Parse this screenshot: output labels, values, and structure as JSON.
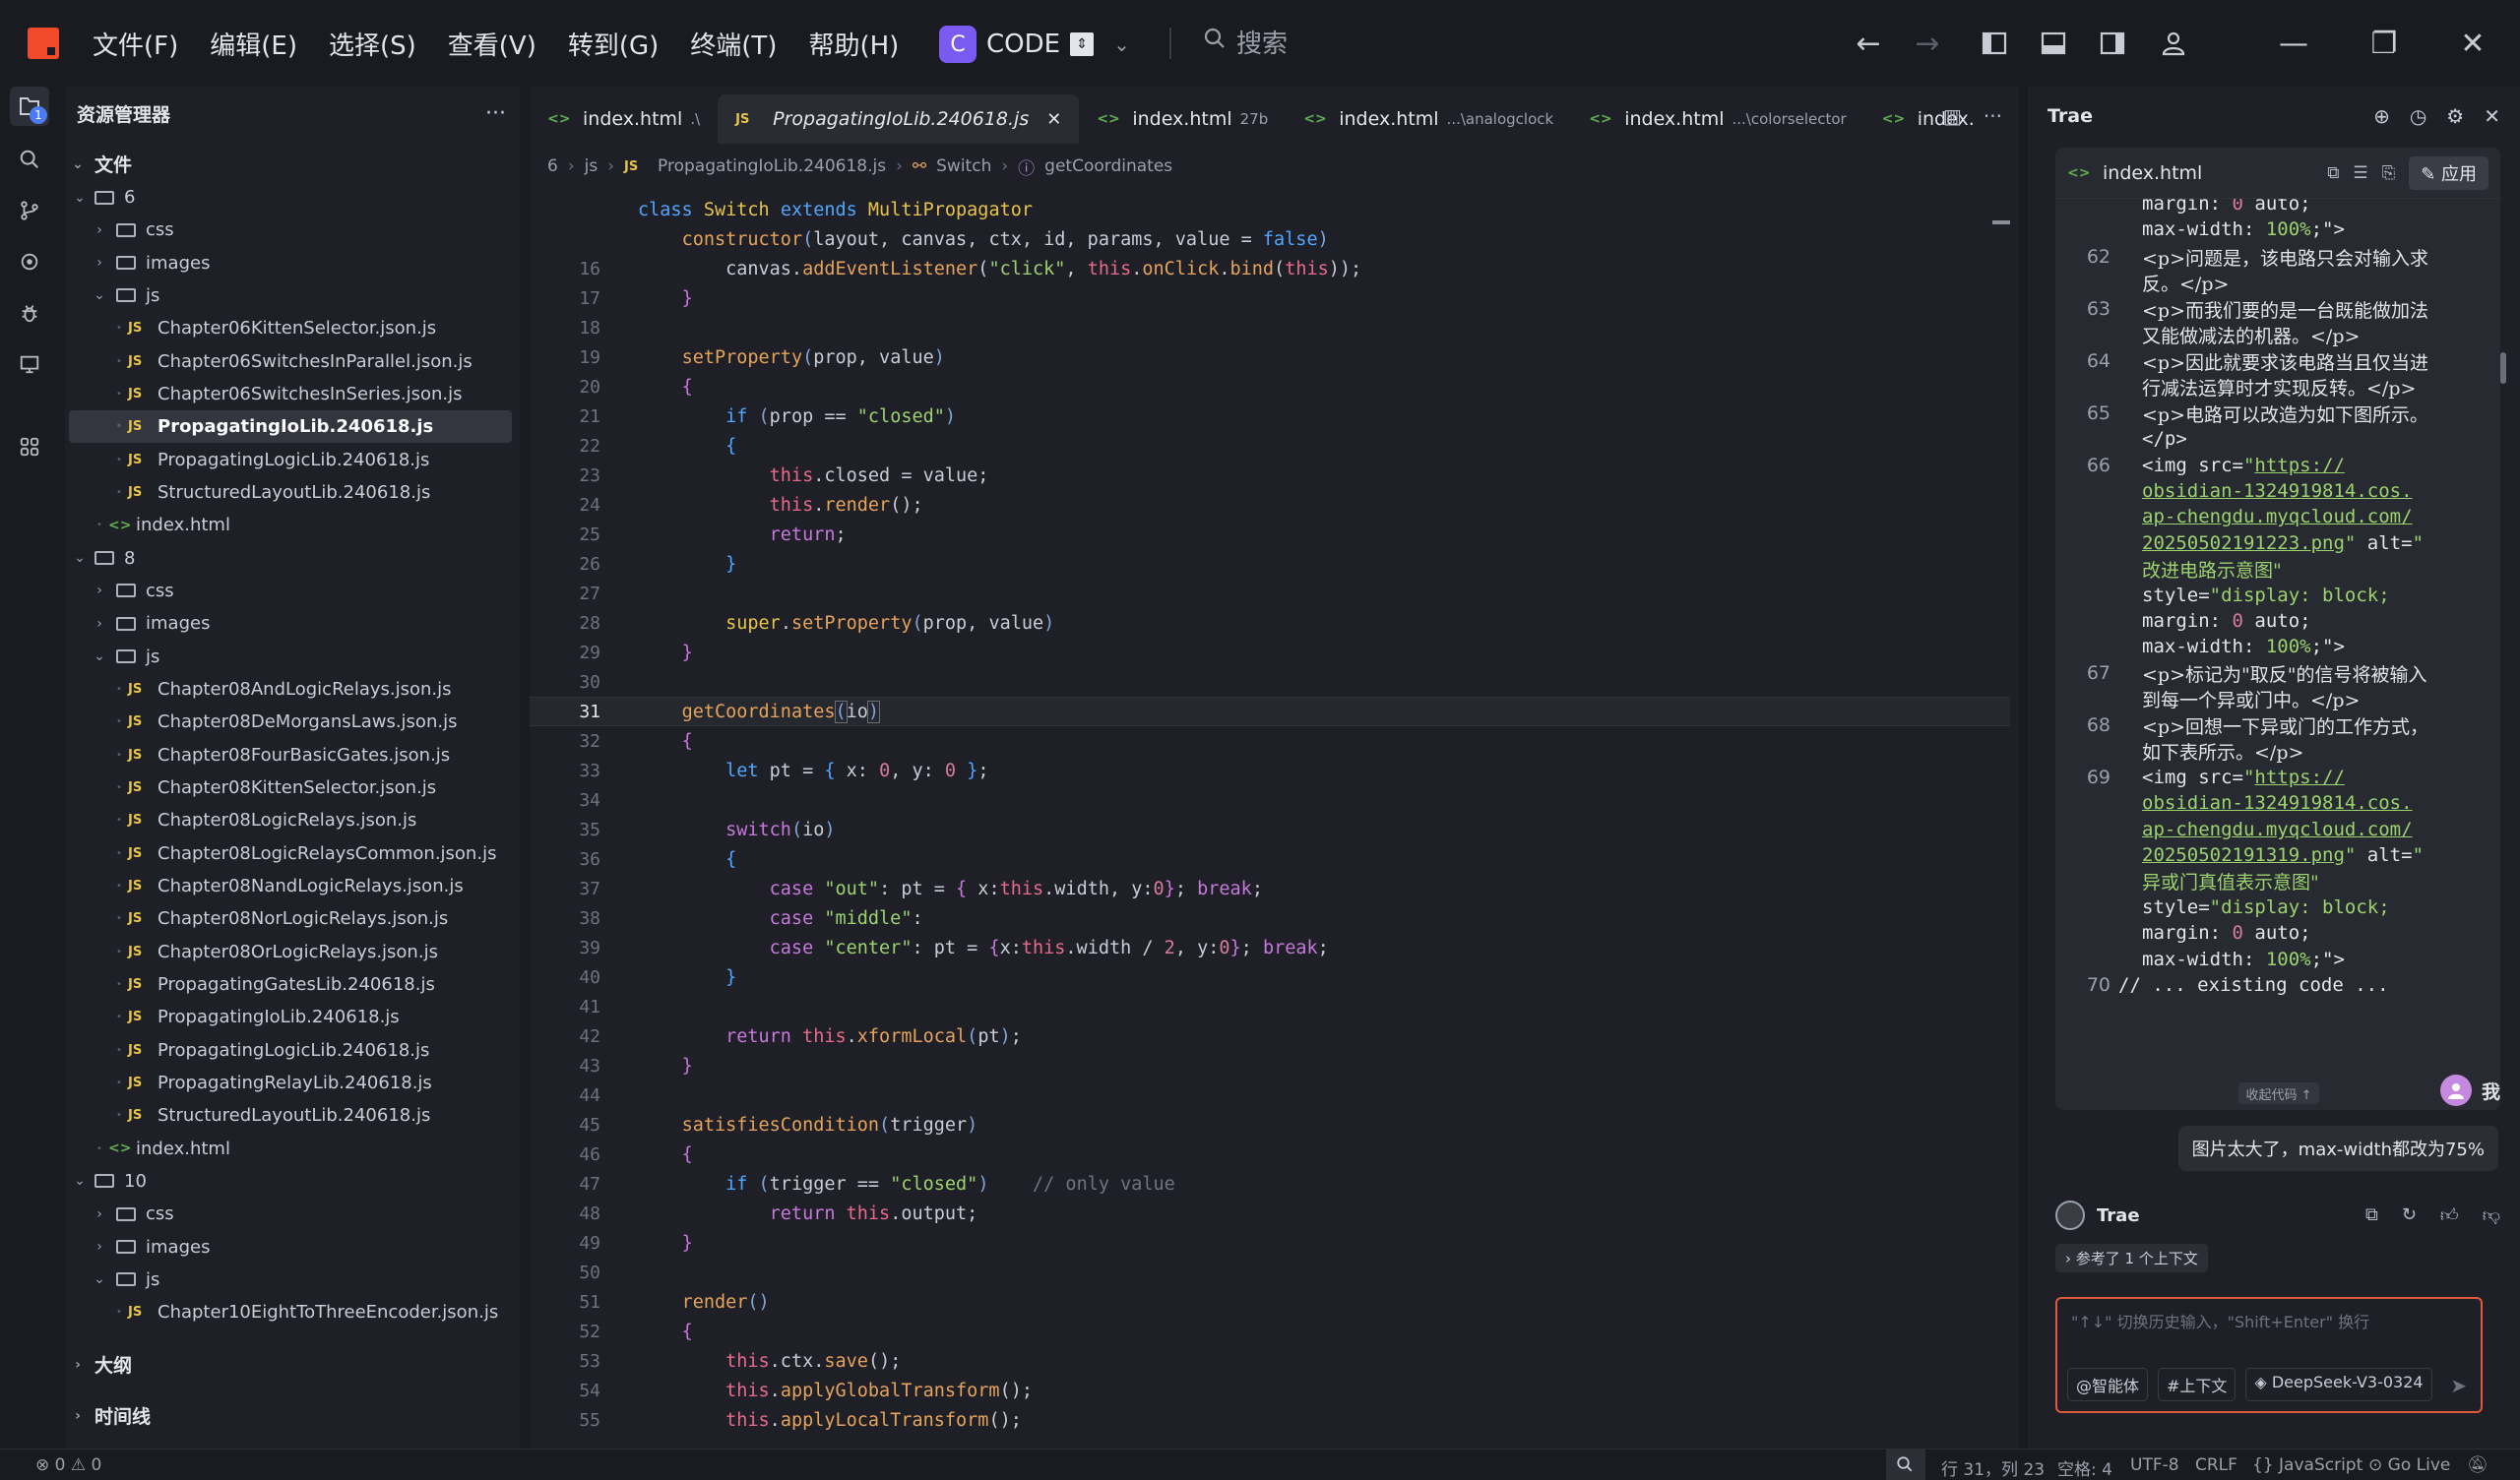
{
  "titlebar": {
    "menu": [
      "文件(F)",
      "编辑(E)",
      "选择(S)",
      "查看(V)",
      "转到(G)",
      "终端(T)",
      "帮助(H)"
    ],
    "project_badge": "C",
    "project_name": "CODE",
    "search_placeholder": "搜索"
  },
  "explorer": {
    "title": "资源管理器",
    "root_label": "文件",
    "rows": [
      {
        "label": "6",
        "kind": "folder"
      },
      {
        "label": "css",
        "kind": "folder"
      },
      {
        "label": "images",
        "kind": "folder"
      },
      {
        "label": "js",
        "kind": "folder"
      },
      {
        "label": "Chapter06KittenSelector.json.js",
        "kind": "js"
      },
      {
        "label": "Chapter06SwitchesInParallel.json.js",
        "kind": "js"
      },
      {
        "label": "Chapter06SwitchesInSeries.json.js",
        "kind": "js"
      },
      {
        "label": "PropagatingIoLib.240618.js",
        "kind": "js"
      },
      {
        "label": "PropagatingLogicLib.240618.js",
        "kind": "js"
      },
      {
        "label": "StructuredLayoutLib.240618.js",
        "kind": "js"
      },
      {
        "label": "index.html",
        "kind": "html"
      },
      {
        "label": "8",
        "kind": "folder"
      },
      {
        "label": "css",
        "kind": "folder"
      },
      {
        "label": "images",
        "kind": "folder"
      },
      {
        "label": "js",
        "kind": "folder"
      },
      {
        "label": "Chapter08AndLogicRelays.json.js",
        "kind": "js"
      },
      {
        "label": "Chapter08DeMorgansLaws.json.js",
        "kind": "js"
      },
      {
        "label": "Chapter08FourBasicGates.json.js",
        "kind": "js"
      },
      {
        "label": "Chapter08KittenSelector.json.js",
        "kind": "js"
      },
      {
        "label": "Chapter08LogicRelays.json.js",
        "kind": "js"
      },
      {
        "label": "Chapter08LogicRelaysCommon.json.js",
        "kind": "js"
      },
      {
        "label": "Chapter08NandLogicRelays.json.js",
        "kind": "js"
      },
      {
        "label": "Chapter08NorLogicRelays.json.js",
        "kind": "js"
      },
      {
        "label": "Chapter08OrLogicRelays.json.js",
        "kind": "js"
      },
      {
        "label": "PropagatingGatesLib.240618.js",
        "kind": "js"
      },
      {
        "label": "PropagatingIoLib.240618.js",
        "kind": "js"
      },
      {
        "label": "PropagatingLogicLib.240618.js",
        "kind": "js"
      },
      {
        "label": "PropagatingRelayLib.240618.js",
        "kind": "js"
      },
      {
        "label": "StructuredLayoutLib.240618.js",
        "kind": "js"
      },
      {
        "label": "index.html",
        "kind": "html"
      },
      {
        "label": "10",
        "kind": "folder"
      },
      {
        "label": "css",
        "kind": "folder"
      },
      {
        "label": "images",
        "kind": "folder"
      },
      {
        "label": "js",
        "kind": "folder"
      },
      {
        "label": "Chapter10EightToThreeEncoder.json.js",
        "kind": "js"
      }
    ],
    "outline_label": "大纲",
    "timeline_label": "时间线"
  },
  "editor": {
    "tabs": [
      {
        "label": "index.html",
        "hint": ".\\"
      },
      {
        "label": "PropagatingIoLib.240618.js",
        "hint": ""
      },
      {
        "label": "index.html",
        "hint": "27b"
      },
      {
        "label": "index.html",
        "hint": "...\\analogclock"
      },
      {
        "label": "index.html",
        "hint": "...\\colorselector"
      },
      {
        "label": "index.",
        "hint": ""
      }
    ],
    "breadcrumb": [
      "6",
      "js",
      "PropagatingIoLib.240618.js",
      "Switch",
      "getCoordinates"
    ],
    "current_line": 31
  },
  "ai": {
    "title": "Trae",
    "file": "index.html",
    "apply_label": "应用",
    "collapse_label": "收起代码 ↑",
    "user_name": "我",
    "user_message": "图片太大了，max-width都改为75%",
    "bot_name": "Trae",
    "ref_label": "参考了 1 个上下文",
    "input_placeholder": "\"↑↓\" 切换历史输入，\"Shift+Enter\" 换行",
    "tool_agent": "@智能体",
    "tool_context": "#上下文",
    "tool_model": "DeepSeek-V3-0324"
  },
  "status": {
    "problems": "0",
    "warnings": "0",
    "position": "行 31，列 23",
    "spaces": "空格: 4",
    "encoding": "UTF-8",
    "eol": "CRLF",
    "language": "JavaScript",
    "golive": "Go Live"
  },
  "colors": {
    "accent": "#f04a2a",
    "project_badge": "#7a5af0",
    "keyword": "#c678dd",
    "string": "#9bd36e",
    "function": "#e6a35a"
  }
}
